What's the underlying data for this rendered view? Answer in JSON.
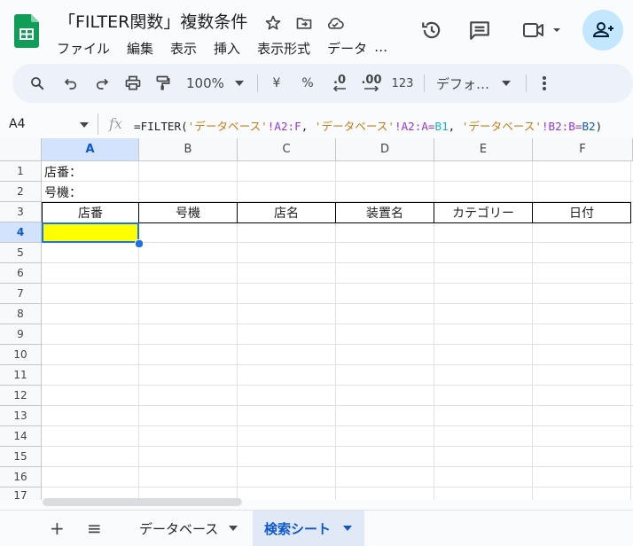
{
  "document": {
    "title": "「FILTER関数」複数条件"
  },
  "menu": {
    "items": [
      "ファイル",
      "編集",
      "表示",
      "挿入",
      "表示形式",
      "データ",
      "…"
    ]
  },
  "toolbar": {
    "zoom": "100%",
    "currency": "¥",
    "percent": "%",
    "dec_decrease": ".0",
    "dec_increase": ".00",
    "number_format": "123",
    "font": "デフォ…"
  },
  "formula_bar": {
    "cell_ref": "A4",
    "fx": "fx",
    "formula": {
      "p1": "=FILTER(",
      "s1": "'データベース'",
      "r1": "!A2:F",
      "c1": ", ",
      "s2": "'データベース'",
      "r2": "!A2:A=",
      "b1": "B1",
      "c2": ", ",
      "s3": "'データベース'",
      "r3": "!B2:B=",
      "b2": "B2",
      "end": ")"
    }
  },
  "grid": {
    "columns": [
      "A",
      "B",
      "C",
      "D",
      "E",
      "F"
    ],
    "rows": [
      "1",
      "2",
      "3",
      "4",
      "5",
      "6",
      "7",
      "8",
      "9",
      "10",
      "11",
      "12",
      "13",
      "14",
      "15",
      "16",
      "17"
    ],
    "a1": "店番：",
    "a2": "号機：",
    "header_row": [
      "店番",
      "号機",
      "店名",
      "装置名",
      "カテゴリー",
      "日付"
    ],
    "active_cell": "A4",
    "active_fill": "#ffff00",
    "accent": "#1a73e8"
  },
  "sheets": {
    "add": "+",
    "list": "≡",
    "tabs": [
      "データベース",
      "検索シート"
    ],
    "active": "検索シート"
  }
}
